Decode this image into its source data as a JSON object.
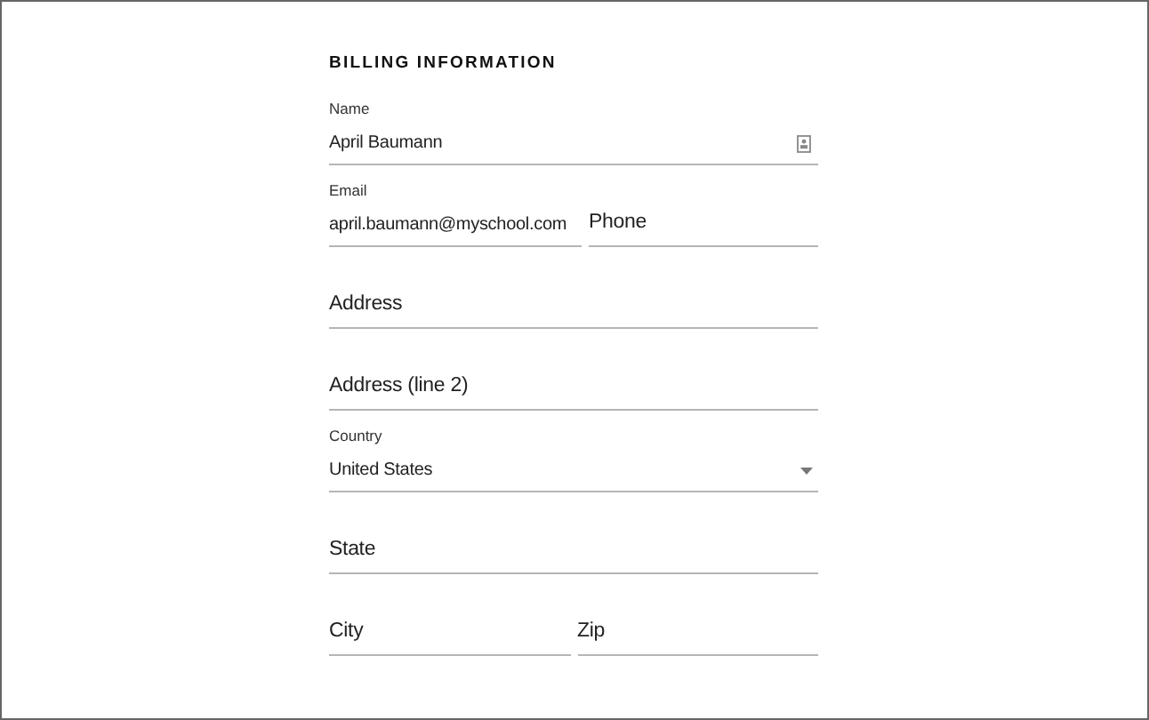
{
  "heading": "BILLING INFORMATION",
  "rows": [
    [
      {
        "kind": "identity",
        "label": "Name",
        "value": "April Baumann"
      }
    ],
    [
      {
        "kind": "text",
        "label": "Email",
        "value": "april.baumann@myschool.com"
      },
      {
        "kind": "empty",
        "placeholder": "Phone"
      }
    ],
    [
      {
        "kind": "empty",
        "placeholder": "Address"
      }
    ],
    [
      {
        "kind": "empty",
        "placeholder": "Address (line 2)"
      }
    ],
    [
      {
        "kind": "select",
        "label": "Country",
        "value": "United States"
      }
    ],
    [
      {
        "kind": "empty",
        "placeholder": "State"
      }
    ],
    [
      {
        "kind": "empty",
        "placeholder": "City"
      },
      {
        "kind": "empty",
        "placeholder": "Zip"
      }
    ]
  ]
}
